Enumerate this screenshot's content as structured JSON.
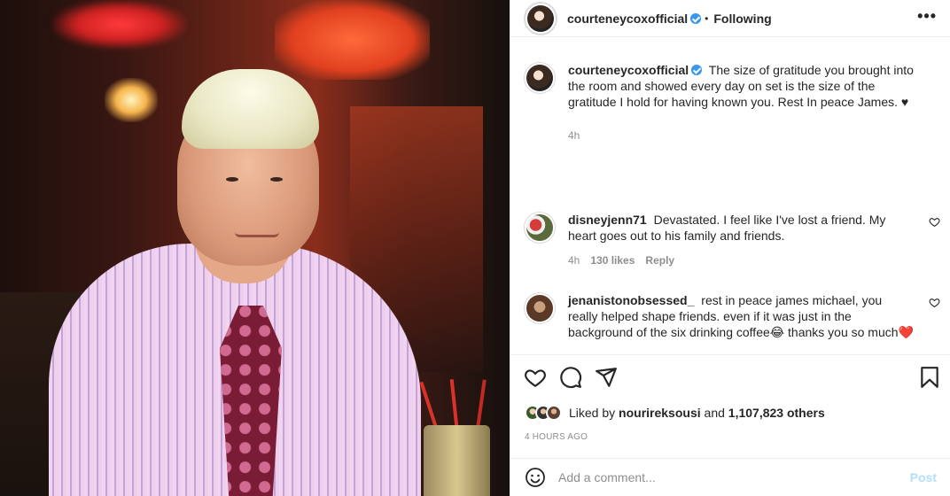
{
  "post": {
    "author": "courteneycoxofficial",
    "follow_separator": "•",
    "follow_status": "Following",
    "more_icon": "more-horizontal-icon"
  },
  "caption": {
    "author": "courteneycoxofficial",
    "text": "The size of gratitude you brought into the room and showed every day on set is the size of the gratitude I hold for having known you. Rest In peace James. ♥",
    "time": "4h"
  },
  "comments": [
    {
      "author": "disneyjenn71",
      "text": "Devastated. I feel like I've lost a friend. My heart goes out to his family and friends.",
      "time": "4h",
      "likes": "130 likes",
      "reply": "Reply"
    },
    {
      "author": "jenanistonobsessed_",
      "text": "rest in peace james michael, you really helped shape friends. even if it was just in the background of the six drinking coffee😂 thanks you so much❤️",
      "time": "",
      "likes": "",
      "reply": ""
    }
  ],
  "likes": {
    "prefix": "Liked by",
    "user": "nourireksousi",
    "middle": "and",
    "count": "1,107,823 others"
  },
  "timestamp": "4 HOURS AGO",
  "add_comment": {
    "placeholder": "Add a comment...",
    "post_label": "Post"
  },
  "colors": {
    "verified": "#3897f0",
    "post_button_disabled": "#b2dffc",
    "meta_text": "#8e8e8e"
  }
}
